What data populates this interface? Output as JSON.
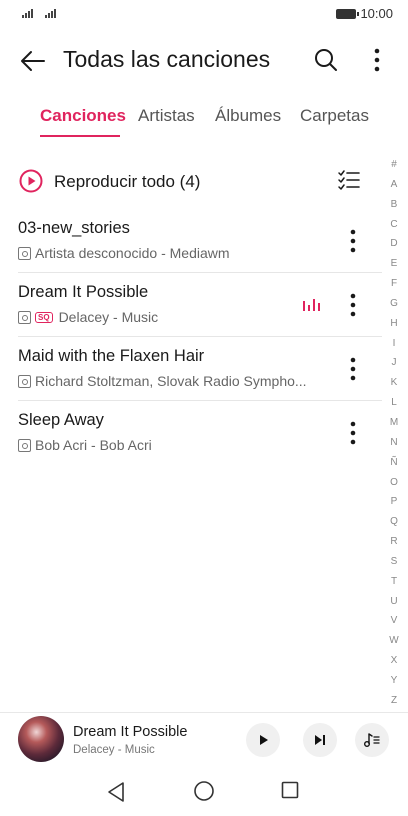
{
  "status_bar": {
    "time": "10:00"
  },
  "header": {
    "title": "Todas las canciones"
  },
  "tabs": [
    {
      "label": "Canciones",
      "active": true
    },
    {
      "label": "Artistas",
      "active": false
    },
    {
      "label": "Álbumes",
      "active": false
    },
    {
      "label": "Carpetas",
      "active": false
    }
  ],
  "play_all": {
    "label": "Reproducir todo (4)"
  },
  "songs": [
    {
      "title": "03-new_stories",
      "subtitle": "Artista desconocido - Mediawm",
      "sq": false,
      "playing": false
    },
    {
      "title": "Dream It Possible",
      "subtitle": "Delacey - Music",
      "sq": true,
      "sq_label": "SQ",
      "playing": true
    },
    {
      "title": "Maid with the Flaxen Hair",
      "subtitle": "Richard Stoltzman, Slovak Radio Sympho...",
      "sq": false,
      "playing": false
    },
    {
      "title": "Sleep Away",
      "subtitle": "Bob Acri - Bob Acri",
      "sq": false,
      "playing": false
    }
  ],
  "alphabet_index": [
    "#",
    "A",
    "B",
    "C",
    "D",
    "E",
    "F",
    "G",
    "H",
    "I",
    "J",
    "K",
    "L",
    "M",
    "N",
    "Ñ",
    "O",
    "P",
    "Q",
    "R",
    "S",
    "T",
    "U",
    "V",
    "W",
    "X",
    "Y",
    "Z"
  ],
  "mini_player": {
    "title": "Dream It Possible",
    "subtitle": "Delacey - Music"
  },
  "colors": {
    "accent": "#e0245e",
    "text": "#1a1a1a",
    "secondary": "#666666"
  },
  "icons": [
    "back-arrow-icon",
    "search-icon",
    "more-vert-icon",
    "play-circle-icon",
    "multi-select-icon",
    "equalizer-icon",
    "play-icon",
    "next-icon",
    "playlist-icon",
    "nav-back-icon",
    "nav-home-icon",
    "nav-recent-icon"
  ]
}
